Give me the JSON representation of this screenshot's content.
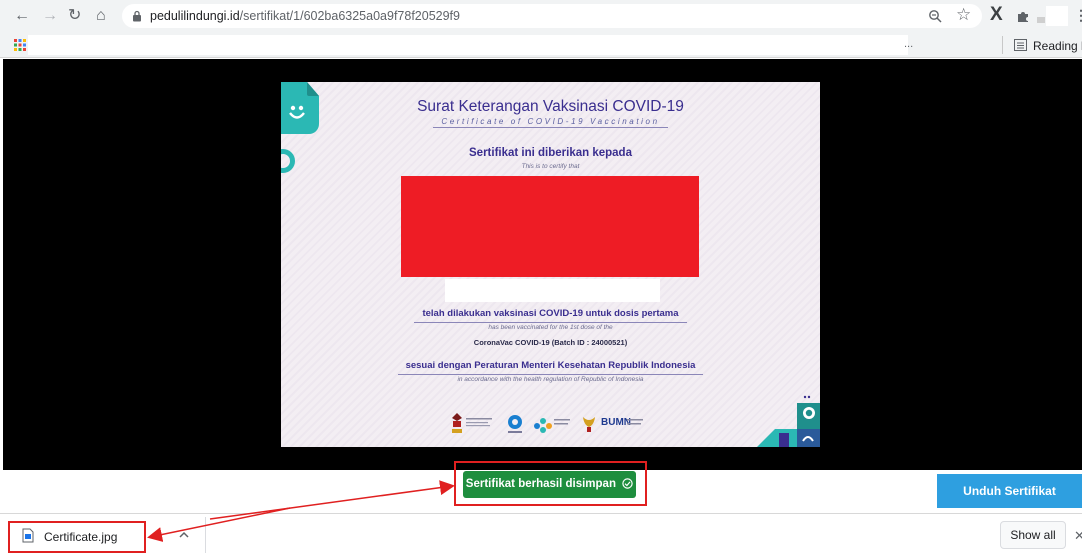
{
  "browser": {
    "url_host": "pedulilindungi.id",
    "url_path": "/sertifikat/1/602ba6325a0a9f78f20529f9",
    "bookmarks_overflow": "...",
    "reading_list_label": "Reading lis"
  },
  "certificate": {
    "title": "Surat Keterangan Vaksinasi COVID-19",
    "subtitle": "Certificate of COVID-19 Vaccination",
    "given_to": "Sertifikat ini diberikan kepada",
    "given_to_en": "This is to certify that",
    "vaccinated_text": "telah dilakukan vaksinasi COVID-19 untuk dosis pertama",
    "vaccinated_text_en": "has been vaccinated for the 1st dose of the",
    "vaccine": "CoronaVac COVID-19 (Batch ID : 24000521)",
    "regulation_text": "sesuai dengan Peraturan Menteri Kesehatan Republik Indonesia",
    "regulation_text_en": "in accordance with the health regulation of Republic of Indonesia",
    "logo_bumn_text": "BUMN"
  },
  "toast": {
    "label": "Sertifikat berhasil disimpan"
  },
  "actions": {
    "download_label": "Unduh Sertifikat"
  },
  "download_bar": {
    "file_name": "Certificate.jpg",
    "show_all_label": "Show all"
  },
  "colors": {
    "redaction": "#ee1c25",
    "toast": "#1e8e3e",
    "download_button": "#2e9fe0",
    "annotation": "#e02020",
    "cert_accent": "#3a2e8f",
    "teal": "#2bb8b4"
  }
}
